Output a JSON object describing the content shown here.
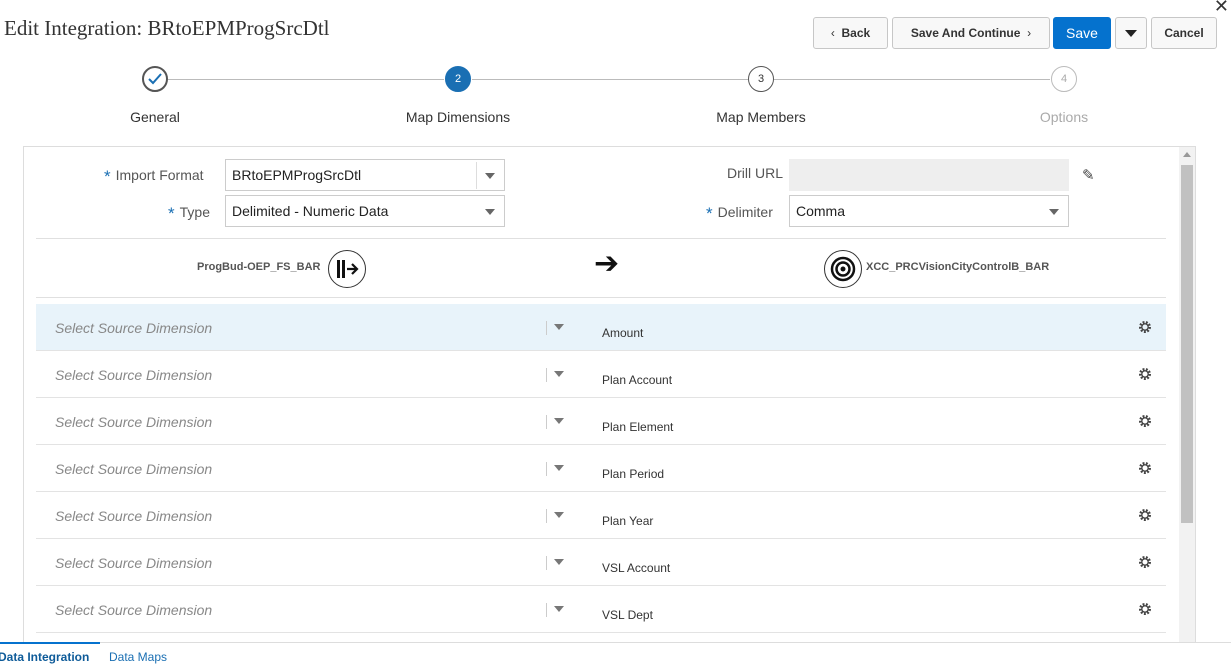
{
  "header": {
    "title": "Edit Integration: BRtoEPMProgSrcDtl",
    "close_glyph": "✕"
  },
  "toolbar": {
    "back_label": "Back",
    "save_continue_label": "Save And Continue",
    "save_label": "Save",
    "cancel_label": "Cancel",
    "accent_color": "#0572ce"
  },
  "train": {
    "steps": [
      {
        "number": "",
        "label": "General",
        "state": "complete"
      },
      {
        "number": "2",
        "label": "Map Dimensions",
        "state": "active"
      },
      {
        "number": "3",
        "label": "Map Members",
        "state": "next"
      },
      {
        "number": "4",
        "label": "Options",
        "state": "future"
      }
    ]
  },
  "form": {
    "import_format_label": "Import Format",
    "import_format_value": "BRtoEPMProgSrcDtl",
    "type_label": "Type",
    "type_value": "Delimited - Numeric Data",
    "drill_url_label": "Drill URL",
    "drill_url_value": "",
    "delimiter_label": "Delimiter",
    "delimiter_value": "Comma",
    "required_mark": "*"
  },
  "mapping": {
    "source_name": "ProgBud-OEP_FS_BAR",
    "target_name": "XCC_PRCVisionCityControlB_BAR",
    "arrow_glyph": "➔",
    "source_placeholder": "Select Source Dimension",
    "rows": [
      {
        "target": "Amount",
        "selected": true
      },
      {
        "target": "Plan Account",
        "selected": false
      },
      {
        "target": "Plan Element",
        "selected": false
      },
      {
        "target": "Plan Period",
        "selected": false
      },
      {
        "target": "Plan Year",
        "selected": false
      },
      {
        "target": "VSL Account",
        "selected": false
      },
      {
        "target": "VSL Dept",
        "selected": false
      }
    ]
  },
  "footer": {
    "tabs": [
      "Data Integration",
      "Data Maps"
    ]
  }
}
